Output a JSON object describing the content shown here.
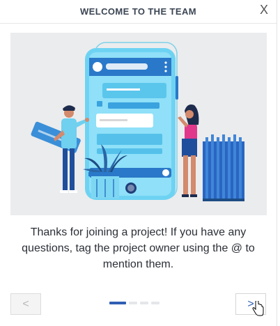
{
  "dialog": {
    "title": "WELCOME TO THE TEAM",
    "close_label": "X",
    "message": "Thanks for joining a project! If you have any questions, tag the project owner using the @ to mention them.",
    "prev_label": "<",
    "next_label": ">",
    "illustration": "team-collaboration-illustration",
    "pagination": {
      "current": 1,
      "total": 4
    }
  },
  "colors": {
    "active_dot": "#2f5fb4",
    "inactive_dot": "#e4e6e9",
    "phone_light": "#6ed3f3",
    "phone_dark": "#2a78c9",
    "accent_pink": "#e2388c"
  }
}
